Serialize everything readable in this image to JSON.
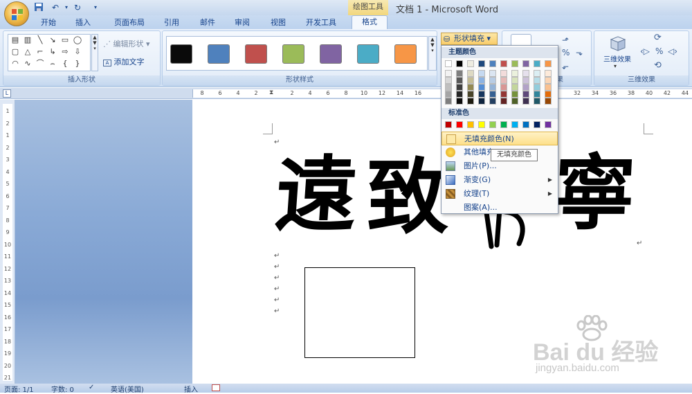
{
  "title_bar": {
    "context_tab": "绘图工具",
    "window_title": "文档 1 - Microsoft Word"
  },
  "tabs": [
    {
      "label": "开始"
    },
    {
      "label": "插入"
    },
    {
      "label": "页面布局"
    },
    {
      "label": "引用"
    },
    {
      "label": "邮件"
    },
    {
      "label": "审阅"
    },
    {
      "label": "视图"
    },
    {
      "label": "开发工具"
    },
    {
      "label": "格式"
    }
  ],
  "ribbon": {
    "insert_shapes": {
      "edit_shape": "编辑形状",
      "add_text": "添加文字",
      "label": "插入形状"
    },
    "shape_styles": {
      "label": "形状样式",
      "swatches": [
        "#0a0a0a",
        "#4f81bd",
        "#c0504d",
        "#9bbb59",
        "#8064a2",
        "#4bacc6",
        "#f79646"
      ],
      "fill_button": "形状填充"
    },
    "shadow_group_tail": "果",
    "effects_3d": {
      "button": "三维效果",
      "label": "三维效果"
    }
  },
  "ruler": {
    "h_ticks": [
      "8",
      "6",
      "4",
      "2",
      "2",
      "4",
      "6",
      "8",
      "10",
      "12",
      "14",
      "16",
      "32",
      "34",
      "36",
      "38",
      "40",
      "42",
      "44"
    ],
    "v_ticks": [
      "1",
      "2",
      "1",
      "2",
      "3",
      "4",
      "5",
      "6",
      "7",
      "8",
      "9",
      "10",
      "11",
      "12",
      "13",
      "14",
      "15",
      "16",
      "17",
      "18",
      "19",
      "20",
      "21"
    ]
  },
  "document": {
    "calligraphy": [
      "遠",
      "致",
      "寧"
    ],
    "para_mark": "↵"
  },
  "fill_menu": {
    "theme_header": "主题颜色",
    "theme_top": [
      "#ffffff",
      "#000000",
      "#eeece1",
      "#1f497d",
      "#4f81bd",
      "#c0504d",
      "#9bbb59",
      "#8064a2",
      "#4bacc6",
      "#f79646"
    ],
    "theme_tints": [
      [
        "#f2f2f2",
        "#7f7f7f",
        "#ddd9c3",
        "#c6d9f0",
        "#dbe5f1",
        "#f2dcdb",
        "#ebf1dd",
        "#e5e0ec",
        "#dbeef3",
        "#fdeada"
      ],
      [
        "#d8d8d8",
        "#595959",
        "#c4bd97",
        "#8db3e2",
        "#b8cce4",
        "#e5b9b7",
        "#d7e3bc",
        "#ccc1d9",
        "#b7dde8",
        "#fbd5b5"
      ],
      [
        "#bfbfbf",
        "#3f3f3f",
        "#938953",
        "#548dd4",
        "#95b3d7",
        "#d99694",
        "#c3d69b",
        "#b2a2c7",
        "#92cddc",
        "#fac08f"
      ],
      [
        "#a5a5a5",
        "#262626",
        "#494429",
        "#17365d",
        "#366092",
        "#953734",
        "#76923c",
        "#5f497a",
        "#31859b",
        "#e36c09"
      ],
      [
        "#7f7f7f",
        "#0c0c0c",
        "#1d1b10",
        "#0f243e",
        "#244061",
        "#632423",
        "#4f6128",
        "#3f3151",
        "#205867",
        "#974806"
      ]
    ],
    "standard_header": "标准色",
    "standard": [
      "#c00000",
      "#ff0000",
      "#ffc000",
      "#ffff00",
      "#92d050",
      "#00b050",
      "#00b0f0",
      "#0070c0",
      "#002060",
      "#7030a0"
    ],
    "no_fill": "无填充颜色(N)",
    "more_fill": "其他填充",
    "picture": "图片(P)...",
    "gradient": "渐变(G)",
    "texture": "纹理(T)",
    "pattern": "图案(A)..."
  },
  "tooltip": "无填充颜色",
  "status_bar": {
    "page": "页面: 1/1",
    "words": "字数: 0",
    "language": "英语(美国)",
    "mode": "插入"
  },
  "watermark": {
    "brand": "Bai du 经验",
    "url": "jingyan.baidu.com"
  }
}
